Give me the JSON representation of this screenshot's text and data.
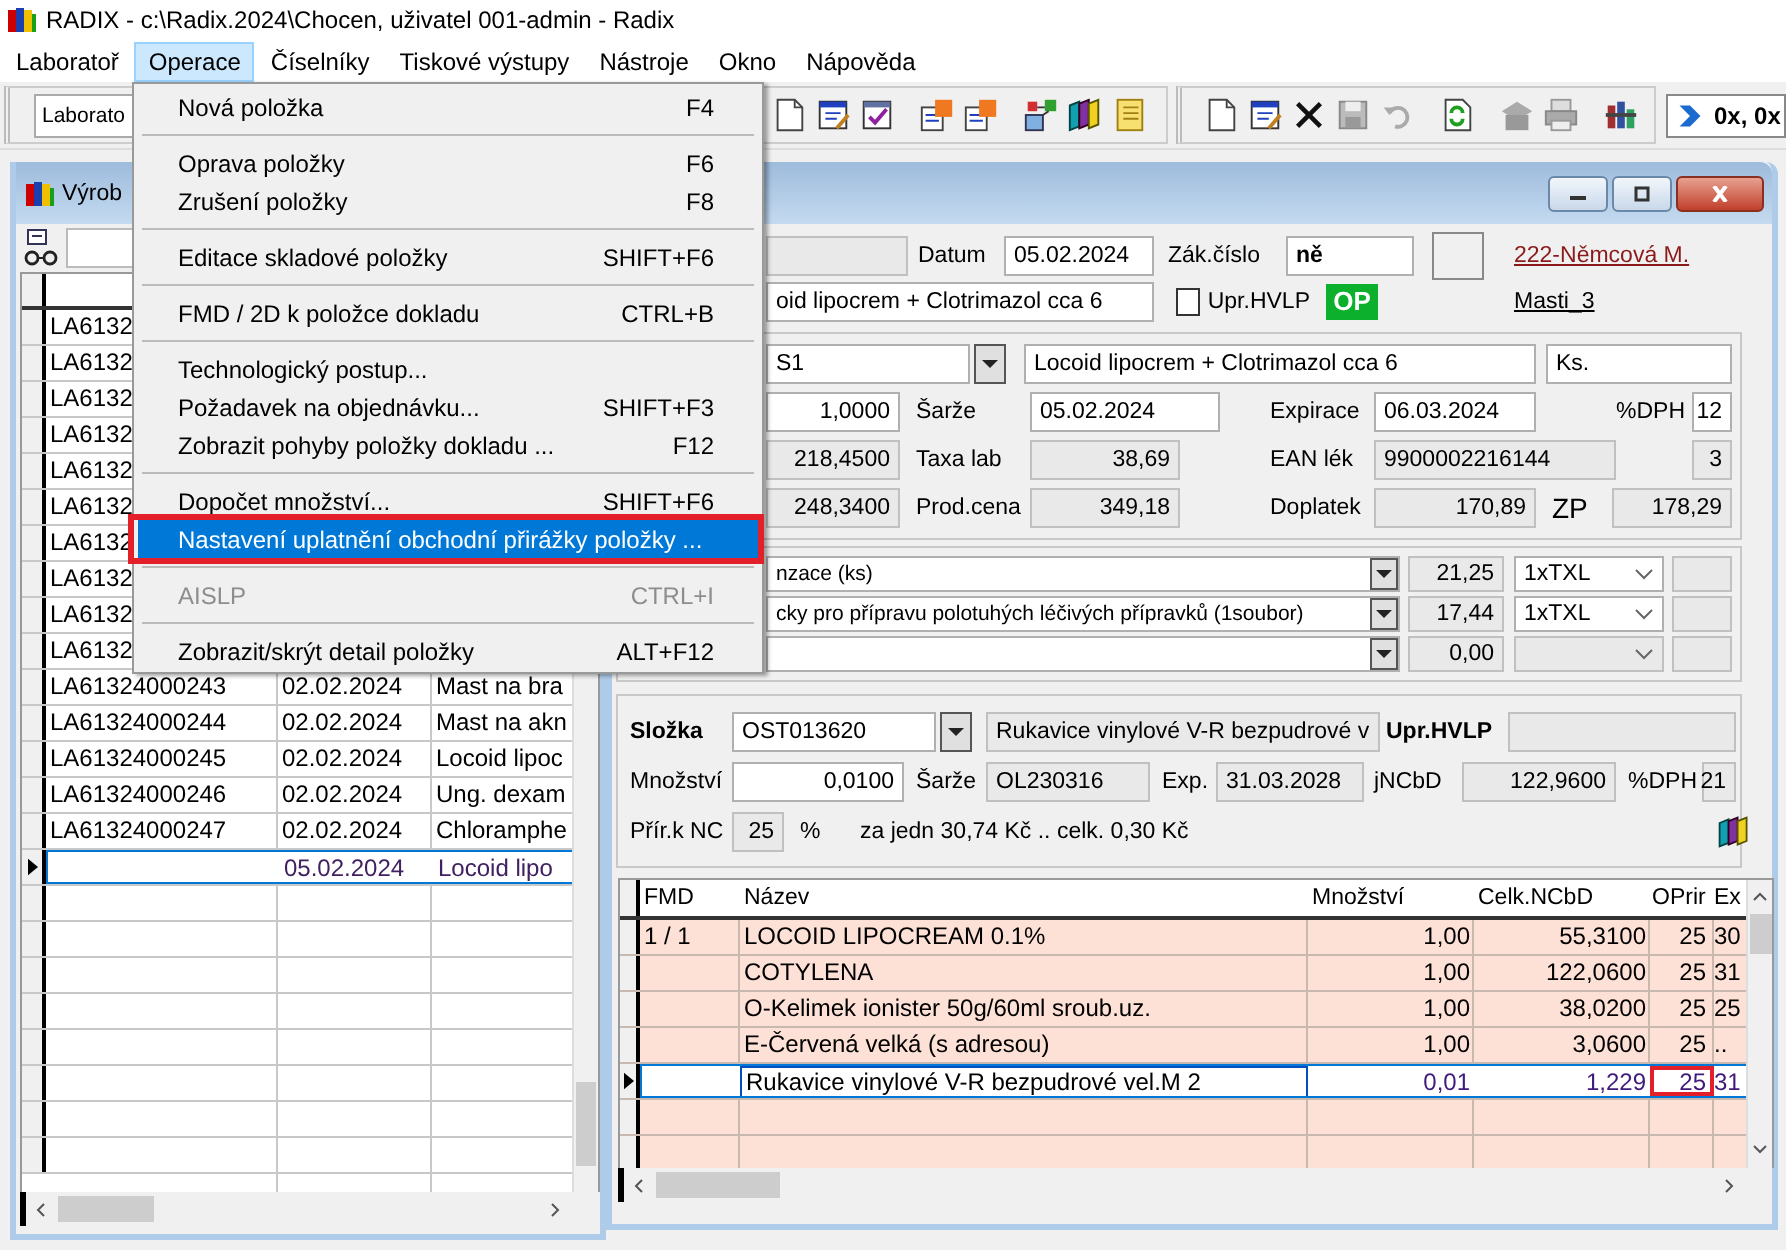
{
  "window": {
    "title": "RADIX - c:\\Radix.2024\\Chocen, uživatel 001-admin - Radix"
  },
  "menu_bar": [
    {
      "label": "Laboratoř",
      "selected": false
    },
    {
      "label": "Operace",
      "selected": true
    },
    {
      "label": "Číselníky",
      "selected": false
    },
    {
      "label": "Tiskové výstupy",
      "selected": false
    },
    {
      "label": "Nástroje",
      "selected": false
    },
    {
      "label": "Okno",
      "selected": false
    },
    {
      "label": "Nápověda",
      "selected": false
    }
  ],
  "toolbar": {
    "combo": "Laborato",
    "position": "0x, 0x"
  },
  "open_menu": [
    [
      {
        "label": "Nová položka",
        "shortcut": "F4",
        "selected": false,
        "disabled": false,
        "highlighted": false
      }
    ],
    [
      {
        "label": "Oprava položky",
        "shortcut": "F6",
        "selected": false,
        "disabled": false,
        "highlighted": false
      },
      {
        "label": "Zrušení položky",
        "shortcut": "F8",
        "selected": false,
        "disabled": false,
        "highlighted": false
      }
    ],
    [
      {
        "label": "Editace skladové položky",
        "shortcut": "SHIFT+F6",
        "selected": false,
        "disabled": false,
        "highlighted": false
      }
    ],
    [
      {
        "label": "FMD / 2D k položce dokladu",
        "shortcut": "CTRL+B",
        "selected": false,
        "disabled": false,
        "highlighted": false
      }
    ],
    [
      {
        "label": "Technologický postup...",
        "selected": false,
        "disabled": false,
        "highlighted": false
      },
      {
        "label": "Požadavek na objednávku...",
        "shortcut": "SHIFT+F3",
        "selected": false,
        "disabled": false,
        "highlighted": false
      },
      {
        "label": "Zobrazit pohyby položky dokladu ...",
        "shortcut": "F12",
        "selected": false,
        "disabled": false,
        "highlighted": false
      }
    ],
    [
      {
        "label": "Dopočet množství...",
        "shortcut": "SHIFT+F6",
        "selected": false,
        "disabled": false,
        "highlighted": false
      },
      {
        "label": "Nastavení uplatnění obchodní přirážky položky ...",
        "selected": true,
        "disabled": false,
        "highlighted": true
      }
    ],
    [
      {
        "label": "AISLP",
        "shortcut": "CTRL+I",
        "selected": false,
        "disabled": true,
        "highlighted": false
      }
    ],
    [
      {
        "label": "Zobrazit/skrýt detail položky",
        "shortcut": "ALT+F12",
        "selected": false,
        "disabled": false,
        "highlighted": false
      }
    ]
  ],
  "list_window": {
    "title": "Výrob",
    "rows": [
      {
        "code": "LA6132",
        "current": false
      },
      {
        "code": "LA6132",
        "current": false
      },
      {
        "code": "LA6132",
        "current": false
      },
      {
        "code": "LA6132",
        "current": false
      },
      {
        "code": "LA6132",
        "current": false
      },
      {
        "code": "LA6132",
        "current": false
      },
      {
        "code": "LA6132",
        "current": false
      },
      {
        "code": "LA6132",
        "current": false
      },
      {
        "code": "LA6132",
        "current": false
      },
      {
        "code": "LA6132",
        "current": false
      },
      {
        "code": "LA61324000243",
        "date": "02.02.2024",
        "name": "Mast na bra",
        "current": false
      },
      {
        "code": "LA61324000244",
        "date": "02.02.2024",
        "name": "Mast na akn",
        "current": false
      },
      {
        "code": "LA61324000245",
        "date": "02.02.2024",
        "name": "Locoid lipoc",
        "current": false
      },
      {
        "code": "LA61324000246",
        "date": "02.02.2024",
        "name": "Ung. dexam",
        "current": false
      },
      {
        "code": "LA61324000247",
        "date": "02.02.2024",
        "name": "Chloramphe",
        "current": false
      },
      {
        "date": "05.02.2024",
        "name": "Locoid lipo",
        "current": true
      }
    ]
  },
  "detail": {
    "header_rows": [
      [
        {
          "kind": "gray"
        },
        {
          "kind": "label",
          "text": "Datum"
        },
        {
          "kind": "field",
          "text": "05.02.2024"
        },
        {
          "kind": "label",
          "text": "Zák.číslo"
        },
        {
          "kind": "field-bold",
          "text": "ně"
        },
        {
          "kind": "box"
        },
        {
          "kind": "link-red",
          "text": "222-Němcová M."
        }
      ],
      [
        {
          "kind": "field",
          "text": "oid lipocrem + Clotrimazol cca 6"
        },
        {
          "kind": "checkbox",
          "text": "Upr.HVLP",
          "checked": false
        },
        {
          "kind": "badge",
          "text": "OP"
        },
        {
          "kind": "link",
          "text": "Masti_3"
        }
      ]
    ],
    "main_rows": [
      [
        {
          "kind": "field",
          "text": "S1"
        },
        {
          "kind": "combo-button"
        },
        {
          "kind": "field",
          "text": "Locoid lipocrem + Clotrimazol cca 6"
        },
        {
          "kind": "field",
          "text": "Ks."
        }
      ],
      [
        {
          "kind": "field-right",
          "text": "1,0000"
        },
        {
          "kind": "label",
          "text": "Šarže"
        },
        {
          "kind": "field",
          "text": "05.02.2024"
        },
        {
          "kind": "label",
          "text": "Expirace"
        },
        {
          "kind": "field",
          "text": "06.03.2024"
        },
        {
          "kind": "label",
          "text": "%DPH"
        },
        {
          "kind": "field-right",
          "text": "12"
        }
      ],
      [
        {
          "kind": "gray-right",
          "text": "218,4500"
        },
        {
          "kind": "label",
          "text": "Taxa lab"
        },
        {
          "kind": "gray-right",
          "text": "38,69"
        },
        {
          "kind": "label",
          "text": "EAN lék"
        },
        {
          "kind": "gray",
          "text": "9900002216144"
        },
        {
          "kind": "gray-right",
          "text": "3"
        }
      ],
      [
        {
          "kind": "gray-right",
          "text": "248,3400"
        },
        {
          "kind": "label",
          "text": "Prod.cena"
        },
        {
          "kind": "gray-right",
          "text": "349,18"
        },
        {
          "kind": "label",
          "text": "Doplatek"
        },
        {
          "kind": "gray-right",
          "text": "170,89"
        },
        {
          "kind": "label-big",
          "text": "ZP"
        },
        {
          "kind": "gray-right",
          "text": "178,29"
        }
      ]
    ],
    "price_rows": [
      [
        {
          "kind": "combo",
          "text": "nzace (ks)"
        },
        {
          "kind": "gray-right",
          "text": "21,25"
        },
        {
          "kind": "select",
          "text": "1xTXL"
        },
        {
          "kind": "gray"
        }
      ],
      [
        {
          "kind": "combo",
          "text": "cky pro přípravu polotuhých léčivých přípravků (1soubor)"
        },
        {
          "kind": "gray-right",
          "text": "17,44"
        },
        {
          "kind": "select",
          "text": "1xTXL"
        },
        {
          "kind": "gray"
        }
      ],
      [
        {
          "kind": "combo"
        },
        {
          "kind": "gray-right",
          "text": "0,00"
        },
        {
          "kind": "select-disabled"
        },
        {
          "kind": "gray"
        }
      ]
    ],
    "component_rows": [
      [
        {
          "kind": "label-bold",
          "text": "Složka"
        },
        {
          "kind": "field",
          "text": "OST013620"
        },
        {
          "kind": "combo-button"
        },
        {
          "kind": "gray",
          "text": "Rukavice vinylové V-R bezpudrové v"
        },
        {
          "kind": "label-bold",
          "text": "Upr.HVLP"
        },
        {
          "kind": "gray"
        }
      ],
      [
        {
          "kind": "label",
          "text": "Množství"
        },
        {
          "kind": "field-right",
          "text": "0,0100"
        },
        {
          "kind": "label",
          "text": "Šarže"
        },
        {
          "kind": "gray",
          "text": "OL230316"
        },
        {
          "kind": "label",
          "text": "Exp."
        },
        {
          "kind": "gray",
          "text": "31.03.2028"
        },
        {
          "kind": "label",
          "text": "jNCbD"
        },
        {
          "kind": "gray-right",
          "text": "122,9600"
        },
        {
          "kind": "label",
          "text": "%DPH"
        },
        {
          "kind": "gray-right",
          "text": "21"
        }
      ],
      [
        {
          "kind": "label",
          "text": "Přír.k NC"
        },
        {
          "kind": "gray-right",
          "text": "25"
        },
        {
          "kind": "label",
          "text": "%"
        },
        {
          "kind": "label",
          "text": "za jedn 30,74 Kč .. celk. 0,30 Kč"
        },
        {
          "kind": "books"
        }
      ]
    ],
    "items": {
      "columns": [
        "FMD",
        "Název",
        "Množství",
        "Celk.NCbD",
        "OPrir",
        "Ex"
      ],
      "rows": [
        {
          "fmd": "1 / 1",
          "name": "LOCOID LIPOCREAM 0.1%",
          "qty": "1,00",
          "total": "55,3100",
          "oprir": "25",
          "ex": "30",
          "current": false,
          "oprir_highlighted": false
        },
        {
          "name": "COTYLENA",
          "qty": "1,00",
          "total": "122,0600",
          "oprir": "25",
          "ex": "31",
          "current": false,
          "oprir_highlighted": false
        },
        {
          "name": "O-Kelimek ionister 50g/60ml sroub.uz.",
          "qty": "1,00",
          "total": "38,0200",
          "oprir": "25",
          "ex": "25",
          "current": false,
          "oprir_highlighted": false
        },
        {
          "name": "E-Červená velká (s adresou)",
          "qty": "1,00",
          "total": "3,0600",
          "oprir": "25",
          "ex": "..",
          "current": false,
          "oprir_highlighted": false
        },
        {
          "name": "Rukavice vinylové V-R bezpudrové vel.M 2",
          "qty": "0,01",
          "total": "1,229",
          "oprir": "25",
          "ex": "31",
          "current": true,
          "oprir_highlighted": true
        }
      ]
    }
  }
}
